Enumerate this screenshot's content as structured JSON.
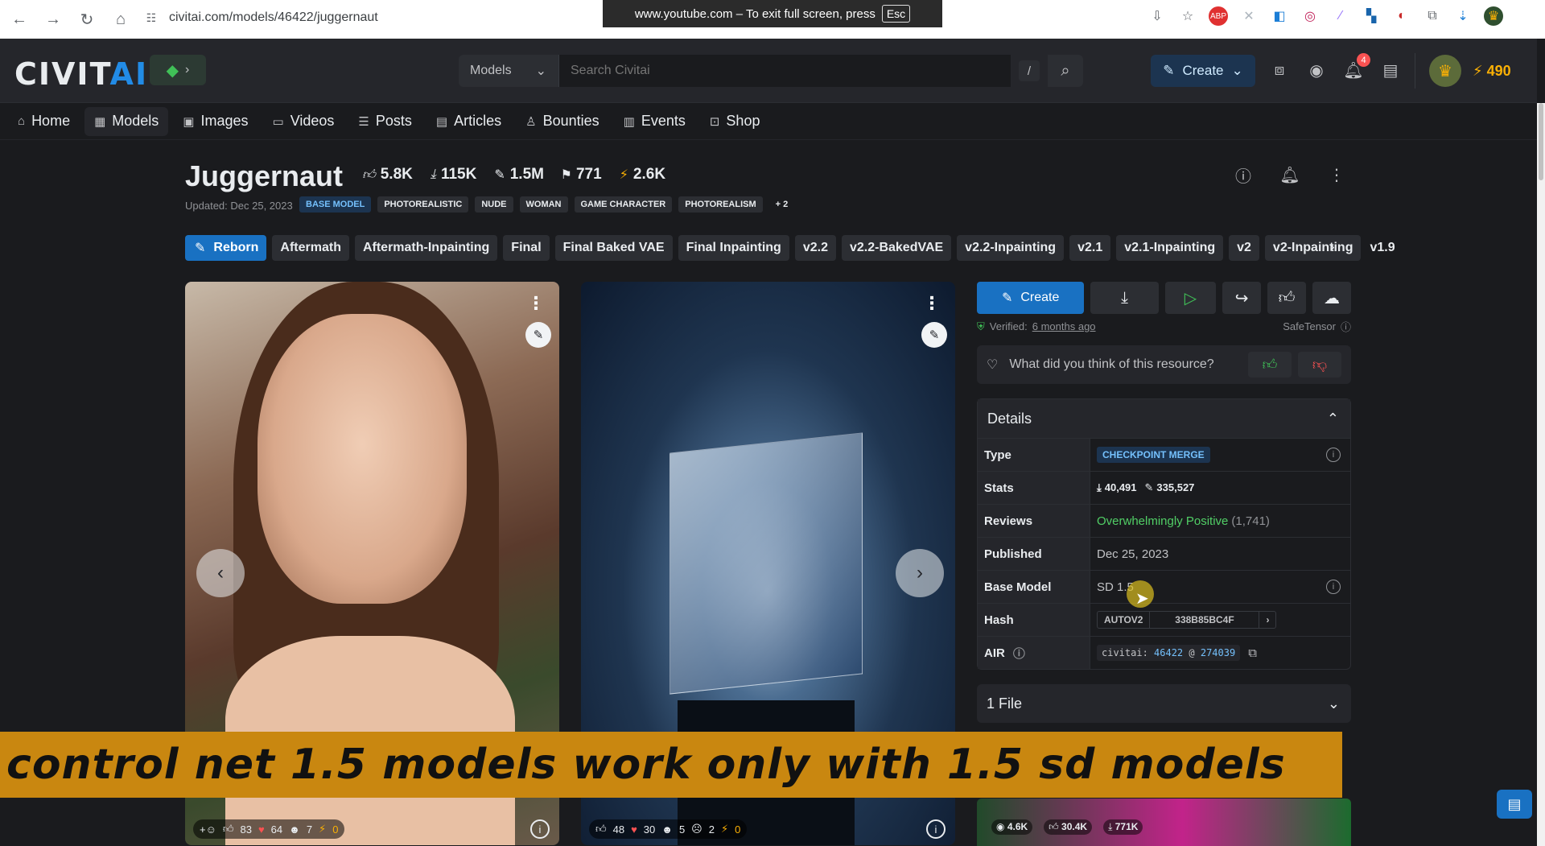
{
  "browser": {
    "url": "civitai.com/models/46422/juggernaut",
    "fullscreen_notice": "www.youtube.com – To exit full screen, press",
    "esc_key": "Esc"
  },
  "header": {
    "logo_main": "CIVIT",
    "logo_ai": "AI",
    "search_type": "Models",
    "search_placeholder": "Search Civitai",
    "search_shortcut": "/",
    "create_label": "Create",
    "notification_count": "4",
    "buzz_amount": "490"
  },
  "nav": [
    {
      "label": "Home",
      "icon": "⌂"
    },
    {
      "label": "Models",
      "icon": "▦"
    },
    {
      "label": "Images",
      "icon": "▣"
    },
    {
      "label": "Videos",
      "icon": "▭"
    },
    {
      "label": "Posts",
      "icon": "☰"
    },
    {
      "label": "Articles",
      "icon": "▤"
    },
    {
      "label": "Bounties",
      "icon": "♙"
    },
    {
      "label": "Events",
      "icon": "▥"
    },
    {
      "label": "Shop",
      "icon": "⊡"
    }
  ],
  "model": {
    "title": "Juggernaut",
    "likes": "5.8K",
    "downloads": "115K",
    "generations": "1.5M",
    "bookmarks": "771",
    "buzz": "2.6K",
    "updated": "Updated: Dec 25, 2023",
    "tags": [
      "BASE MODEL",
      "PHOTOREALISTIC",
      "NUDE",
      "WOMAN",
      "GAME CHARACTER",
      "PHOTOREALISM",
      "+ 2"
    ],
    "versions": [
      "Reborn",
      "Aftermath",
      "Aftermath-Inpainting",
      "Final",
      "Final Baked VAE",
      "Final Inpainting",
      "v2.2",
      "v2.2-BakedVAE",
      "v2.2-Inpainting",
      "v2.1",
      "v2.1-Inpainting",
      "v2",
      "v2-Inpainting",
      "v1.9"
    ]
  },
  "gallery": {
    "card1": {
      "reactions": [
        "83",
        "64",
        "7",
        "0"
      ]
    },
    "card2": {
      "reactions": [
        "48",
        "30",
        "5",
        "2",
        "0"
      ]
    }
  },
  "sidebar": {
    "create_label": "Create",
    "verified_label": "Verified:",
    "verified_time": "6 months ago",
    "safetensor": "SafeTensor",
    "feedback_prompt": "What did you think of this resource?",
    "details_title": "Details",
    "details": {
      "type_key": "Type",
      "type_val": "CHECKPOINT MERGE",
      "stats_key": "Stats",
      "stats_downloads": "40,491",
      "stats_generations": "335,527",
      "reviews_key": "Reviews",
      "reviews_val": "Overwhelmingly Positive",
      "reviews_count": "(1,741)",
      "published_key": "Published",
      "published_val": "Dec 25, 2023",
      "base_key": "Base Model",
      "base_val": "SD 1.5",
      "hash_key": "Hash",
      "hash_type": "AUTOV2",
      "hash_val": "338B85BC4F",
      "air_key": "AIR",
      "air_prefix": "civitai:",
      "air_id": "46422",
      "air_at": "@",
      "air_ver": "274039"
    },
    "files_label": "1 File"
  },
  "caption": "control net 1.5 models work only with 1.5 sd models",
  "bottom_card": {
    "views": "4.6K",
    "likes": "30.4K",
    "downloads": "771K"
  }
}
